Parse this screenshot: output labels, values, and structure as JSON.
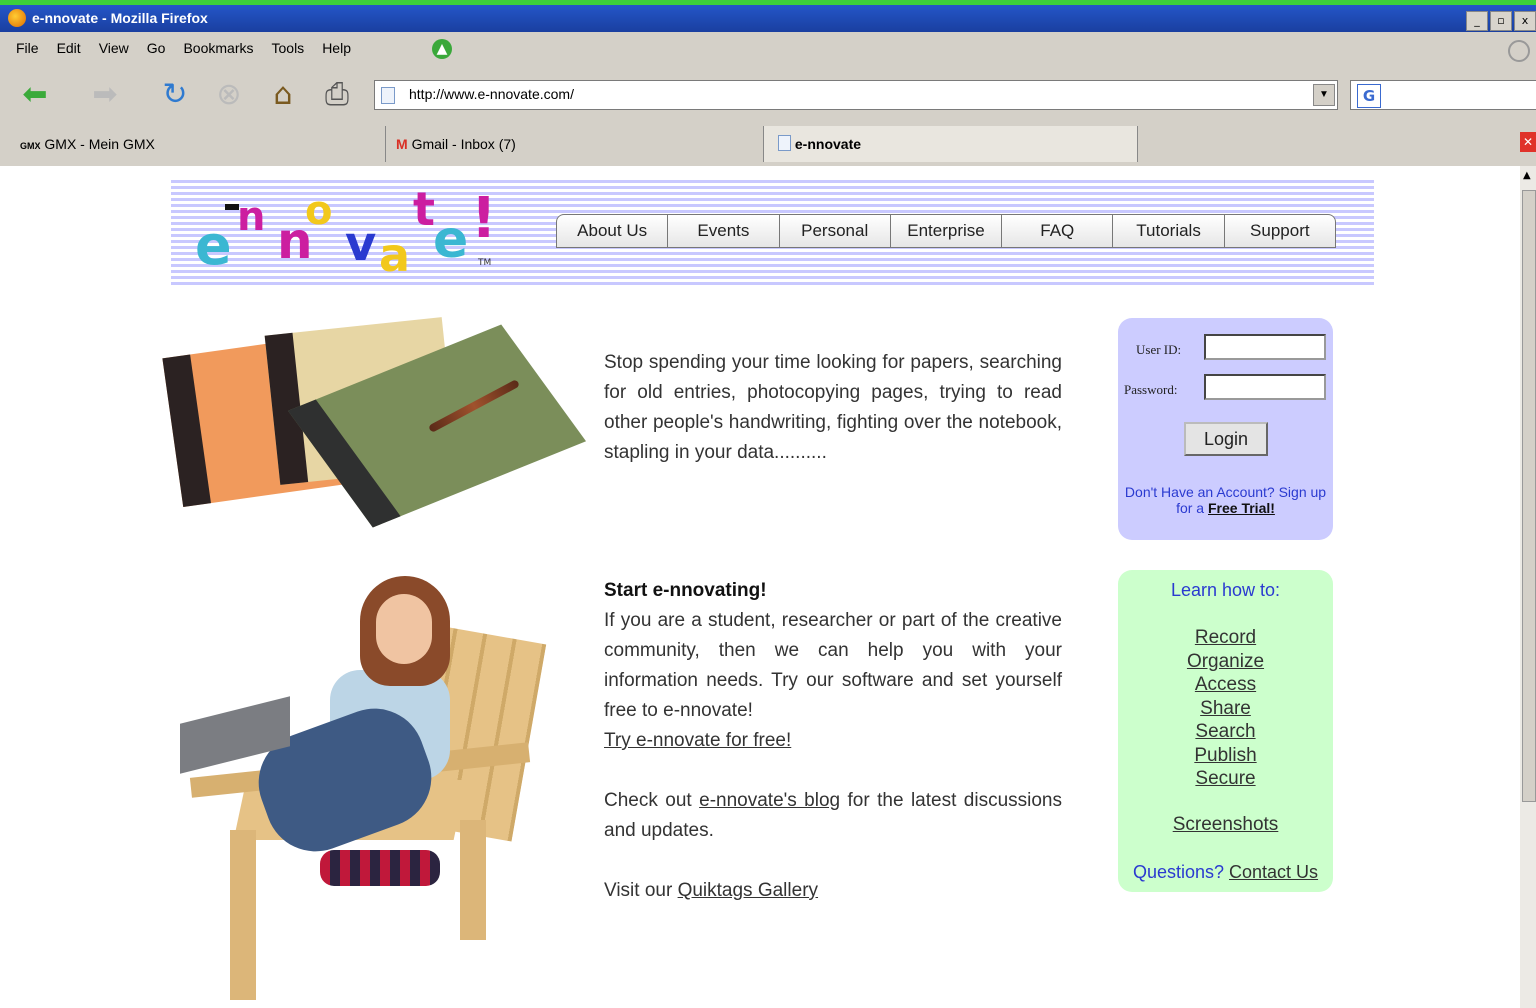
{
  "window": {
    "title": "e-nnovate - Mozilla Firefox",
    "controls": [
      "_",
      "▫",
      "x"
    ]
  },
  "menu": [
    "File",
    "Edit",
    "View",
    "Go",
    "Bookmarks",
    "Tools",
    "Help"
  ],
  "address": {
    "url": "http://www.e-nnovate.com/"
  },
  "search": {
    "engine_letter": "G"
  },
  "tabs": [
    {
      "label": "GMX - Mein GMX",
      "icon": "gmx-icon",
      "active": false
    },
    {
      "label": "Gmail - Inbox (7)",
      "icon": "gmail-icon",
      "active": false
    },
    {
      "label": "e-nnovate",
      "icon": "page-icon",
      "active": true
    }
  ],
  "site": {
    "logo": {
      "letters": [
        "e",
        "n",
        "n",
        "o",
        "v",
        "a",
        "t",
        "e",
        "!"
      ],
      "tm": "TM"
    },
    "nav": [
      "About Us",
      "Events",
      "Personal",
      "Enterprise",
      "FAQ",
      "Tutorials",
      "Support"
    ],
    "intro": "Stop spending your time looking for papers, searching for old entries, photocopying pages, trying to read other people's handwriting, fighting over the notebook, stapling in your data..........",
    "login": {
      "user_label": "User ID:",
      "password_label": "Password:",
      "button": "Login",
      "note_prefix": "Don't Have an Account? Sign up for a ",
      "note_link": "Free Trial!"
    },
    "start": {
      "heading": "Start e-nnovating!",
      "body": "If you are a student, researcher or part of the creative community, then we can help you with your information needs. Try our software and set yourself free to e-nnovate!",
      "try_link": "Try e-nnovate for free!",
      "blog_prefix": "Check out",
      "blog_link": "e-nnovate's blog",
      "blog_suffix": "for the latest discussions and updates.",
      "gallery_prefix": "Visit our",
      "gallery_link": "Quiktags Gallery"
    },
    "learn": {
      "heading": "Learn how to:",
      "links": [
        "Record",
        "Organize",
        "Access",
        "Share",
        "Search",
        "Publish",
        "Secure"
      ],
      "screenshots": "Screenshots",
      "questions": "Questions?",
      "contact": "Contact Us"
    }
  },
  "colors": {
    "titlebar": "#2456c8",
    "login_panel": "#ccccff",
    "learn_panel": "#ccffcc",
    "link_blue": "#2a3ad0"
  }
}
